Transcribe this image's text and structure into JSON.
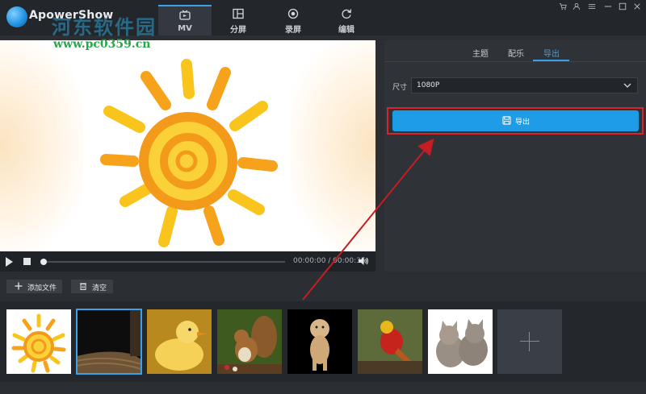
{
  "app": {
    "name": "ApowerShow"
  },
  "watermark": {
    "site_cn": "河东软件园",
    "url": "www.pc0359.cn"
  },
  "nav": {
    "tabs": [
      {
        "label": "MV",
        "icon": "tv-icon",
        "active": true
      },
      {
        "label": "分屏",
        "icon": "split-screen-icon",
        "active": false
      },
      {
        "label": "录屏",
        "icon": "record-icon",
        "active": false
      },
      {
        "label": "编辑",
        "icon": "refresh-edit-icon",
        "active": false
      }
    ]
  },
  "window_controls": [
    "cart-icon",
    "user-icon",
    "menu-icon",
    "minimize-icon",
    "maximize-icon",
    "close-icon"
  ],
  "player": {
    "time": "00:00:00 / 00:00:35"
  },
  "right_panel": {
    "tabs": [
      {
        "label": "主题",
        "active": false
      },
      {
        "label": "配乐",
        "active": false
      },
      {
        "label": "导出",
        "active": true
      }
    ],
    "size_label": "尺寸",
    "size_value": "1080P",
    "export_label": "导出"
  },
  "toolbar": {
    "add_file_label": "添加文件",
    "clear_label": "清空"
  },
  "media": {
    "items": [
      {
        "subject": "sun-drawing",
        "selected": false
      },
      {
        "subject": "dark-fabric",
        "selected": true
      },
      {
        "subject": "duckling",
        "selected": false
      },
      {
        "subject": "squirrel",
        "selected": false
      },
      {
        "subject": "cheetah-cub",
        "selected": false
      },
      {
        "subject": "golden-pheasant",
        "selected": false
      },
      {
        "subject": "kittens",
        "selected": false
      }
    ]
  },
  "colors": {
    "accent": "#1e9de6",
    "highlight_frame": "#d8242a",
    "arrow": "#c41e24",
    "background": "#2b2e33"
  }
}
